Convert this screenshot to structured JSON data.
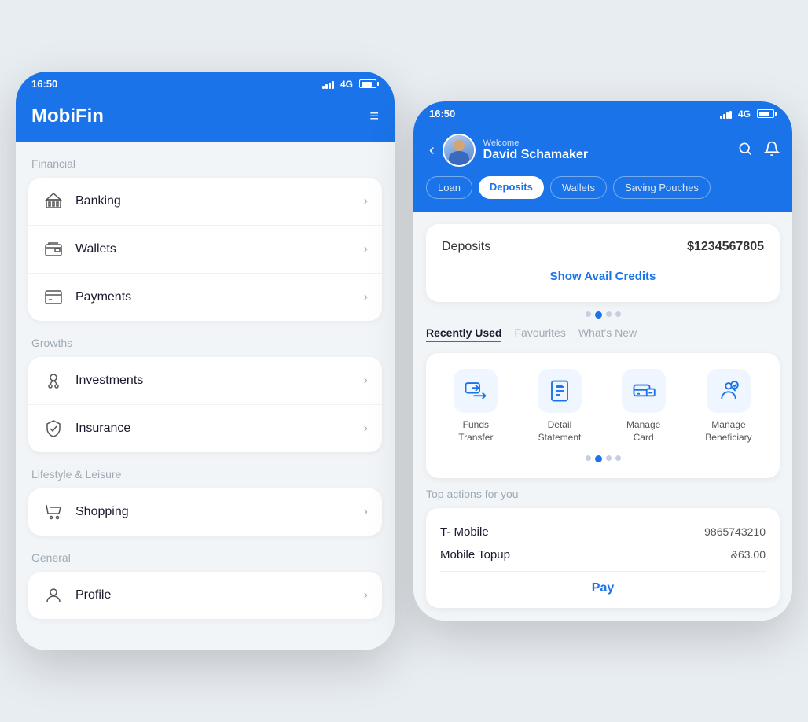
{
  "left_phone": {
    "status_bar": {
      "time": "16:50",
      "network": "4G"
    },
    "top_bar": {
      "title": "MobiFin",
      "menu_icon": "≡"
    },
    "sections": [
      {
        "label": "Financial",
        "items": [
          {
            "id": "banking",
            "label": "Banking",
            "icon": "bank"
          },
          {
            "id": "wallets",
            "label": "Wallets",
            "icon": "wallet"
          },
          {
            "id": "payments",
            "label": "Payments",
            "icon": "payment"
          }
        ]
      },
      {
        "label": "Growths",
        "items": [
          {
            "id": "investments",
            "label": "Investments",
            "icon": "invest"
          },
          {
            "id": "insurance",
            "label": "Insurance",
            "icon": "insurance"
          }
        ]
      },
      {
        "label": "Lifestyle & Leisure",
        "items": [
          {
            "id": "shopping",
            "label": "Shopping",
            "icon": "shopping"
          }
        ]
      },
      {
        "label": "General",
        "items": [
          {
            "id": "profile",
            "label": "Profile",
            "icon": "profile"
          }
        ]
      }
    ]
  },
  "right_phone": {
    "status_bar": {
      "time": "16:50",
      "network": "4G"
    },
    "header": {
      "welcome_text": "Welcome",
      "user_name": "David Schamaker",
      "search_icon": "🔍",
      "bell_icon": "🔔"
    },
    "tabs": [
      {
        "label": "Loan",
        "active": false
      },
      {
        "label": "Deposits",
        "active": true
      },
      {
        "label": "Wallets",
        "active": false
      },
      {
        "label": "Saving Pouches",
        "active": false
      }
    ],
    "deposit_card": {
      "label": "Deposits",
      "amount": "$1234567805",
      "show_credits_label": "Show Avail Credits"
    },
    "dots": [
      {
        "active": false
      },
      {
        "active": true
      },
      {
        "active": false
      },
      {
        "active": false
      }
    ],
    "section_tabs": [
      {
        "label": "Recently Used",
        "active": true
      },
      {
        "label": "Favourites",
        "active": false
      },
      {
        "label": "What's New",
        "active": false
      }
    ],
    "quick_actions": [
      {
        "label": "Funds\nTransfer",
        "icon": "transfer"
      },
      {
        "label": "Detail\nStatement",
        "icon": "statement"
      },
      {
        "label": "Manage\nCard",
        "icon": "card"
      },
      {
        "label": "Manage\nBeneficiary",
        "icon": "beneficiary"
      }
    ],
    "action_dots": [
      {
        "active": false
      },
      {
        "active": true
      },
      {
        "active": false
      },
      {
        "active": false
      }
    ],
    "top_actions": {
      "label": "Top actions for you",
      "items": [
        {
          "name": "T- Mobile",
          "value": "9865743210"
        },
        {
          "name": "Mobile Topup",
          "value": "&63.00"
        }
      ],
      "pay_label": "Pay"
    }
  }
}
